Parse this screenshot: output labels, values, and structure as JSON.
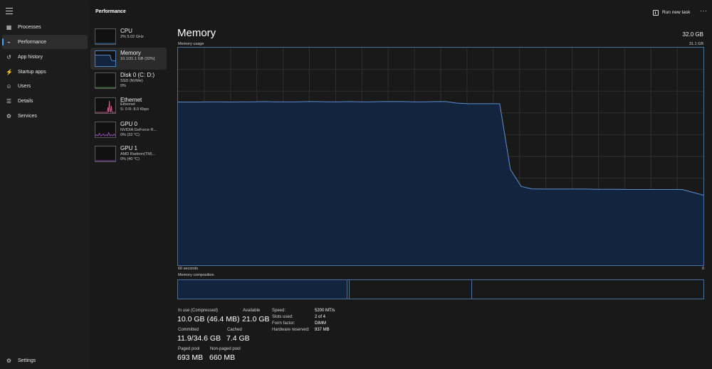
{
  "nav": {
    "items": [
      {
        "label": "Processes",
        "icon": "processes-icon"
      },
      {
        "label": "Performance",
        "icon": "performance-icon",
        "active": true
      },
      {
        "label": "App history",
        "icon": "app-history-icon"
      },
      {
        "label": "Startup apps",
        "icon": "startup-apps-icon"
      },
      {
        "label": "Users",
        "icon": "users-icon"
      },
      {
        "label": "Details",
        "icon": "details-icon"
      },
      {
        "label": "Services",
        "icon": "services-icon"
      }
    ],
    "settings_label": "Settings"
  },
  "header": {
    "title": "Performance",
    "run_new_task": "Run new task",
    "more": "···"
  },
  "devices": [
    {
      "name": "CPU",
      "line1": "2%  5.02 GHz",
      "line2": ""
    },
    {
      "name": "Memory",
      "line1": "10.1/31.1 GB (32%)",
      "line2": "",
      "active": true
    },
    {
      "name": "Disk 0 (C: D:)",
      "line1": "SSD (NVMe)",
      "line2": "0%"
    },
    {
      "name": "Ethernet",
      "line1": "Ethernet",
      "line2": "S: 0  R: 8.0 Kbps"
    },
    {
      "name": "GPU 0",
      "line1": "NVIDIA GeForce R...",
      "line2": "0%  (32 °C)"
    },
    {
      "name": "GPU 1",
      "line1": "AMD Radeon(TM)...",
      "line2": "0%  (40 °C)"
    }
  ],
  "memory": {
    "title": "Memory",
    "total": "32.0 GB",
    "usage_label": "Memory usage",
    "usage_max": "31.1 GB",
    "axis_left": "60 seconds",
    "axis_right": "0",
    "composition_label": "Memory composition",
    "composition_fractions": {
      "in_use": 0.322,
      "modified": 0.004,
      "standby": 0.233
    },
    "usage_history_fraction": [
      0.75,
      0.75,
      0.75,
      0.751,
      0.751,
      0.75,
      0.751,
      0.751,
      0.752,
      0.751,
      0.751,
      0.751,
      0.752,
      0.752,
      0.751,
      0.751,
      0.752,
      0.751,
      0.751,
      0.752,
      0.752,
      0.752,
      0.751,
      0.751,
      0.752,
      0.752,
      0.745,
      0.742,
      0.742,
      0.742,
      0.742,
      0.44,
      0.362,
      0.351,
      0.35,
      0.35,
      0.35,
      0.35,
      0.35,
      0.349,
      0.349,
      0.349,
      0.348,
      0.348,
      0.348,
      0.348,
      0.348,
      0.348,
      0.335,
      0.322
    ],
    "stats": {
      "in_use_label": "In use (Compressed)",
      "in_use_value": "10.0 GB (46.4 MB)",
      "available_label": "Available",
      "available_value": "21.0 GB",
      "committed_label": "Committed",
      "committed_value": "11.9/34.6 GB",
      "cached_label": "Cached",
      "cached_value": "7.4 GB",
      "paged_label": "Paged pool",
      "paged_value": "693 MB",
      "nonpaged_label": "Non-paged pool",
      "nonpaged_value": "660 MB"
    },
    "specs": [
      {
        "label": "Speed:",
        "value": "5200 MT/s"
      },
      {
        "label": "Slots used:",
        "value": "2 of 4"
      },
      {
        "label": "Form factor:",
        "value": "DIMM"
      },
      {
        "label": "Hardware reserved:",
        "value": "937 MB"
      }
    ]
  },
  "colors": {
    "accent": "#4aa3ff",
    "graph_line": "#5e8fd0",
    "graph_fill": "#13243f",
    "ethernet_trace": "#d25b8b",
    "gpu_trace": "#9a4fbe"
  }
}
